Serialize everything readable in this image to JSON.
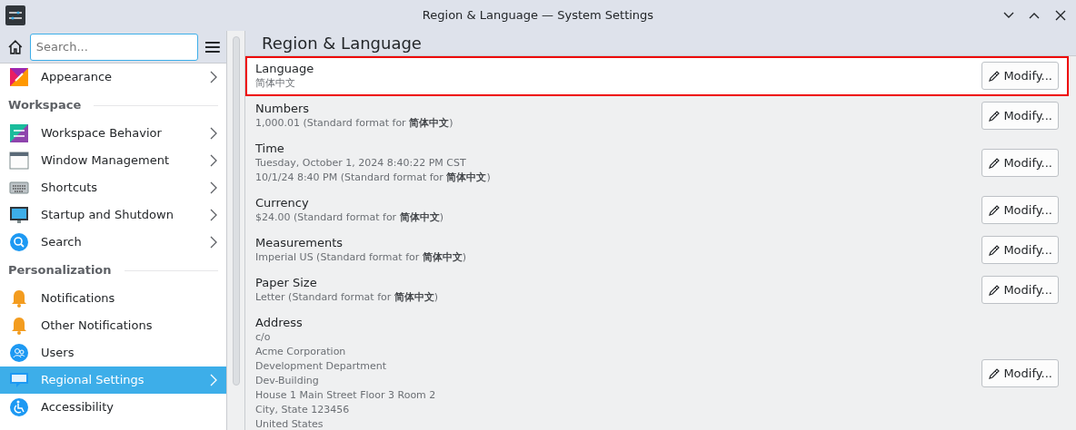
{
  "window": {
    "title": "Region & Language — System Settings"
  },
  "sidebar": {
    "search": {
      "placeholder": "Search..."
    },
    "items": [
      {
        "kind": "item",
        "label": "Appearance",
        "selected": false
      },
      {
        "kind": "section",
        "label": "Workspace"
      },
      {
        "kind": "item",
        "label": "Workspace Behavior",
        "selected": false
      },
      {
        "kind": "item",
        "label": "Window Management",
        "selected": false
      },
      {
        "kind": "item",
        "label": "Shortcuts",
        "selected": false
      },
      {
        "kind": "item",
        "label": "Startup and Shutdown",
        "selected": false
      },
      {
        "kind": "item",
        "label": "Search",
        "selected": false
      },
      {
        "kind": "section",
        "label": "Personalization"
      },
      {
        "kind": "item",
        "label": "Notifications",
        "selected": false,
        "arrow": false
      },
      {
        "kind": "item",
        "label": "Other Notifications",
        "selected": false,
        "arrow": false
      },
      {
        "kind": "item",
        "label": "Users",
        "selected": false,
        "arrow": false
      },
      {
        "kind": "item",
        "label": "Regional Settings",
        "selected": true
      },
      {
        "kind": "item",
        "label": "Accessibility",
        "selected": false,
        "arrow": false
      }
    ]
  },
  "page": {
    "title": "Region & Language",
    "settings": [
      {
        "label": "Language",
        "lines": [
          "简体中文"
        ],
        "highlighted": true,
        "button": "Modify..."
      },
      {
        "label": "Numbers",
        "lines": [
          "1,000.01 (Standard format for **简体中文**)"
        ],
        "highlighted": false,
        "button": "Modify..."
      },
      {
        "label": "Time",
        "lines": [
          "Tuesday, October 1, 2024 8:40:22 PM CST",
          "10/1/24 8:40 PM (Standard format for **简体中文**)"
        ],
        "highlighted": false,
        "button": "Modify..."
      },
      {
        "label": "Currency",
        "lines": [
          "$24.00 (Standard format for **简体中文**)"
        ],
        "highlighted": false,
        "button": "Modify..."
      },
      {
        "label": "Measurements",
        "lines": [
          "Imperial US (Standard format for **简体中文**)"
        ],
        "highlighted": false,
        "button": "Modify..."
      },
      {
        "label": "Paper Size",
        "lines": [
          "Letter (Standard format for **简体中文**)"
        ],
        "highlighted": false,
        "button": "Modify..."
      },
      {
        "label": "Address",
        "lines": [
          "c/o",
          "Acme Corporation",
          "Development Department",
          "Dev-Building",
          "House 1 Main Street Floor 3 Room 2",
          "City, State 123456",
          "United States"
        ],
        "highlighted": false,
        "button": "Modify..."
      }
    ]
  }
}
